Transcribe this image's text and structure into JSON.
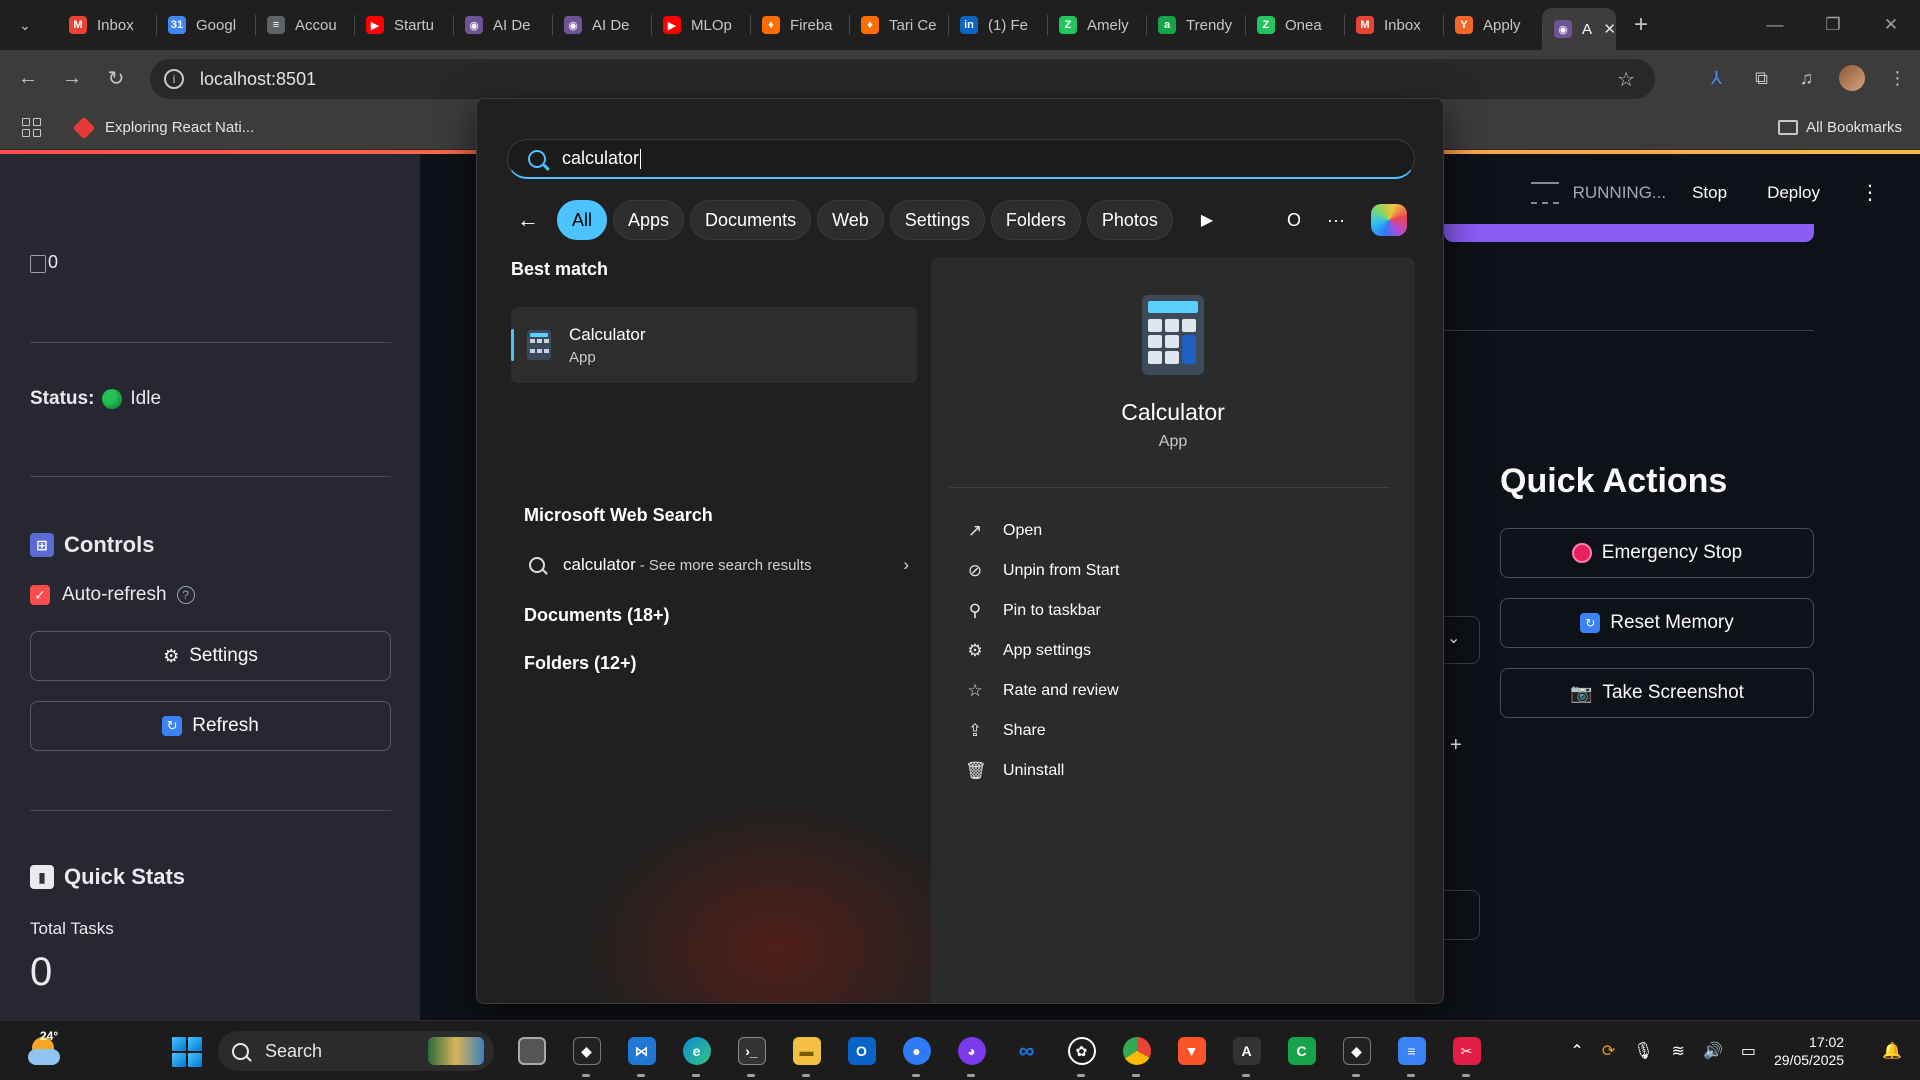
{
  "browser": {
    "tabs": [
      {
        "label": "Inbox",
        "icon": "gmail-icon",
        "color": "#ea4335",
        "glyph": "M"
      },
      {
        "label": "Googl",
        "icon": "calendar-icon",
        "color": "#4285f4",
        "glyph": "31"
      },
      {
        "label": "Accou",
        "icon": "doc-icon",
        "color": "#5f6368",
        "glyph": "≡"
      },
      {
        "label": "Startu",
        "icon": "youtube-icon",
        "color": "#ff0000",
        "glyph": "▶"
      },
      {
        "label": "AI De",
        "icon": "app-icon",
        "color": "#6e5494",
        "glyph": "◉"
      },
      {
        "label": "AI De",
        "icon": "app-icon",
        "color": "#6e5494",
        "glyph": "◉"
      },
      {
        "label": "MLOp",
        "icon": "youtube-icon",
        "color": "#ff0000",
        "glyph": "▶"
      },
      {
        "label": "Fireba",
        "icon": "firebase-icon",
        "color": "#ff6d00",
        "glyph": "♦"
      },
      {
        "label": "Tari Ce",
        "icon": "firebase-icon",
        "color": "#ff6d00",
        "glyph": "♦"
      },
      {
        "label": "(1) Fe",
        "icon": "linkedin-icon",
        "color": "#0a66c2",
        "glyph": "in"
      },
      {
        "label": "Amely",
        "icon": "app-icon",
        "color": "#22c55e",
        "glyph": "Z"
      },
      {
        "label": "Trendy",
        "icon": "app-icon",
        "color": "#16a34a",
        "glyph": "a"
      },
      {
        "label": "Onea",
        "icon": "app-icon",
        "color": "#22c55e",
        "glyph": "Z"
      },
      {
        "label": "Inbox",
        "icon": "gmail-icon",
        "color": "#ea4335",
        "glyph": "M"
      },
      {
        "label": "Apply",
        "icon": "ycombinator-icon",
        "color": "#f26522",
        "glyph": "Y"
      }
    ],
    "active_tab": {
      "label": "A",
      "icon": "app-icon",
      "color": "#6e5494",
      "glyph": "◉",
      "close": "✕"
    },
    "url": "localhost:8501",
    "bookmark": "Exploring React Nati...",
    "all_bookmarks": "All Bookmarks"
  },
  "app": {
    "sidebar": {
      "image_alt": "0",
      "status_label": "Status:",
      "status_value": "Idle",
      "controls_title": "Controls",
      "auto_refresh_label": "Auto-refresh",
      "settings_button": "Settings",
      "refresh_button": "Refresh",
      "quick_stats_title": "Quick Stats",
      "total_tasks_label": "Total Tasks",
      "total_tasks_value": "0"
    },
    "header": {
      "running": "RUNNING...",
      "stop": "Stop",
      "deploy": "Deploy"
    },
    "quick_actions": {
      "title": "Quick Actions",
      "emergency_stop": "Emergency Stop",
      "reset_memory": "Reset Memory",
      "take_screenshot": "Take Screenshot"
    }
  },
  "search_flyout": {
    "query": "calculator",
    "filters": [
      "All",
      "Apps",
      "Documents",
      "Web",
      "Settings",
      "Folders",
      "Photos"
    ],
    "selected_filter": "All",
    "extra_letter": "O",
    "best_match_heading": "Best match",
    "best_match": {
      "name": "Calculator",
      "type": "App"
    },
    "web_search_heading": "Microsoft Web Search",
    "web_query": "calculator",
    "web_more": "- See more search results",
    "documents_group": "Documents (18+)",
    "folders_group": "Folders (12+)",
    "preview": {
      "name": "Calculator",
      "type": "App",
      "actions": [
        "Open",
        "Unpin from Start",
        "Pin to taskbar",
        "App settings",
        "Rate and review",
        "Share",
        "Uninstall"
      ]
    }
  },
  "taskbar": {
    "temperature": "24°",
    "search_label": "Search",
    "time": "17:02",
    "date": "29/05/2025"
  }
}
